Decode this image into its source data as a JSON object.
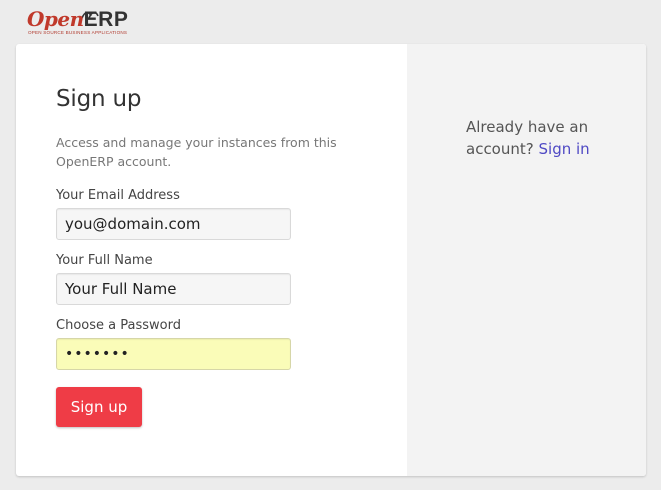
{
  "brand": {
    "logo_open": "Open",
    "logo_erp": "ERP",
    "tagline": "OPEN SOURCE BUSINESS APPLICATIONS",
    "colors": {
      "open": "#c0392b",
      "erp": "#333333"
    }
  },
  "signup": {
    "title": "Sign up",
    "description": "Access and manage your instances from this OpenERP account.",
    "email_label": "Your Email Address",
    "email_value": "you@domain.com",
    "name_label": "Your Full Name",
    "name_value": "Your Full Name",
    "password_label": "Choose a Password",
    "password_value": "•••••••",
    "submit_label": "Sign up",
    "submit_color": "#ef3c46"
  },
  "side": {
    "prompt": "Already have an account?",
    "signin_link": "Sign in",
    "link_color": "#4f49c4"
  }
}
